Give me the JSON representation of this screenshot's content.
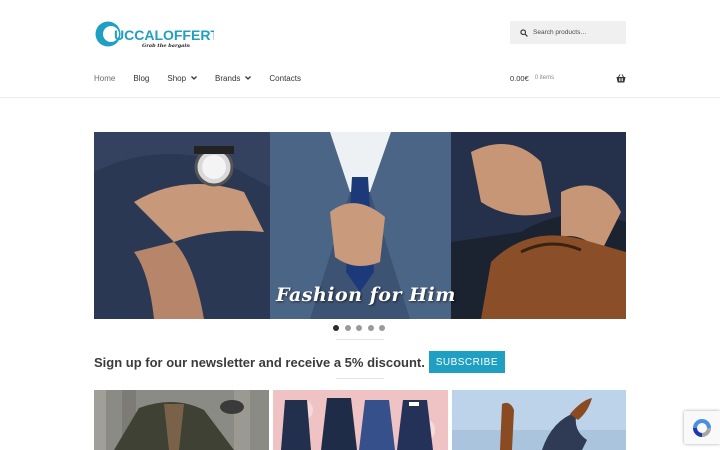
{
  "site": {
    "logo_text": "UCCALOFFERTA",
    "logo_tagline": "Grab the bargain",
    "brand_color": "#1fa0c3"
  },
  "search": {
    "placeholder": "Search products…",
    "icon": "search-icon"
  },
  "nav": {
    "items": [
      {
        "label": "Home"
      },
      {
        "label": "Blog"
      },
      {
        "label": "Shop"
      },
      {
        "label": "Brands"
      },
      {
        "label": "Contacts"
      }
    ]
  },
  "cart": {
    "amount": "0.00€",
    "count": "0 items",
    "icon": "basket-icon"
  },
  "slider": {
    "caption": "Fashion for Him",
    "slide_count": 5,
    "active_slide": 1
  },
  "newsletter": {
    "text": "Sign up for our newsletter and receive a 5% discount.",
    "button": "SUBSCRIBE"
  }
}
